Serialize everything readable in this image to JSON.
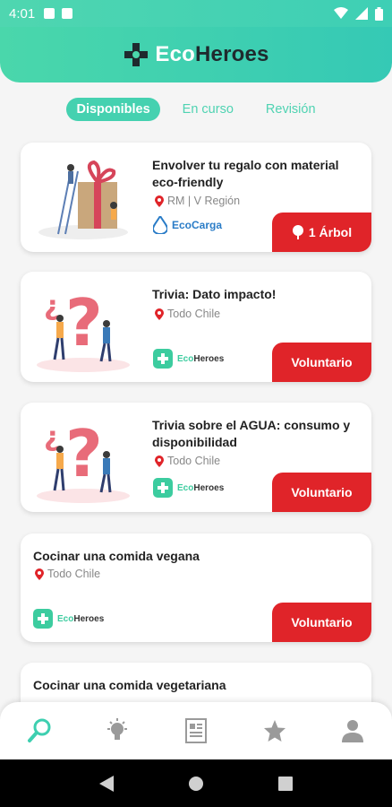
{
  "status": {
    "time": "4:01"
  },
  "header": {
    "logo_eco": "Eco",
    "logo_heroes": "Heroes"
  },
  "tabs": [
    {
      "label": "Disponibles",
      "active": true
    },
    {
      "label": "En curso",
      "active": false
    },
    {
      "label": "Revisión",
      "active": false
    }
  ],
  "cards": [
    {
      "title": "Envolver tu regalo con material eco-friendly",
      "location": "RM | V Región",
      "brand": "EcoCarga",
      "cta": "1 Árbol"
    },
    {
      "title": "Trivia: Dato impacto!",
      "location": "Todo Chile",
      "brand": "EcoHeroes",
      "cta": "Voluntario"
    },
    {
      "title": "Trivia sobre el AGUA: consumo y disponibilidad",
      "location": "Todo Chile",
      "brand": "EcoHeroes",
      "cta": "Voluntario"
    },
    {
      "title": "Cocinar una comida vegana",
      "location": "Todo Chile",
      "brand": "EcoHeroes",
      "cta": "Voluntario"
    },
    {
      "title": "Cocinar una comida vegetariana"
    }
  ],
  "brand_parts": {
    "eco": "Eco",
    "heroes": "Heroes",
    "ecocarga": "EcoCarga"
  },
  "colors": {
    "accent": "#45d1b0",
    "cta": "#e02429"
  },
  "bottom_nav": [
    "search-icon",
    "lightbulb-icon",
    "document-icon",
    "star-icon",
    "user-icon"
  ]
}
